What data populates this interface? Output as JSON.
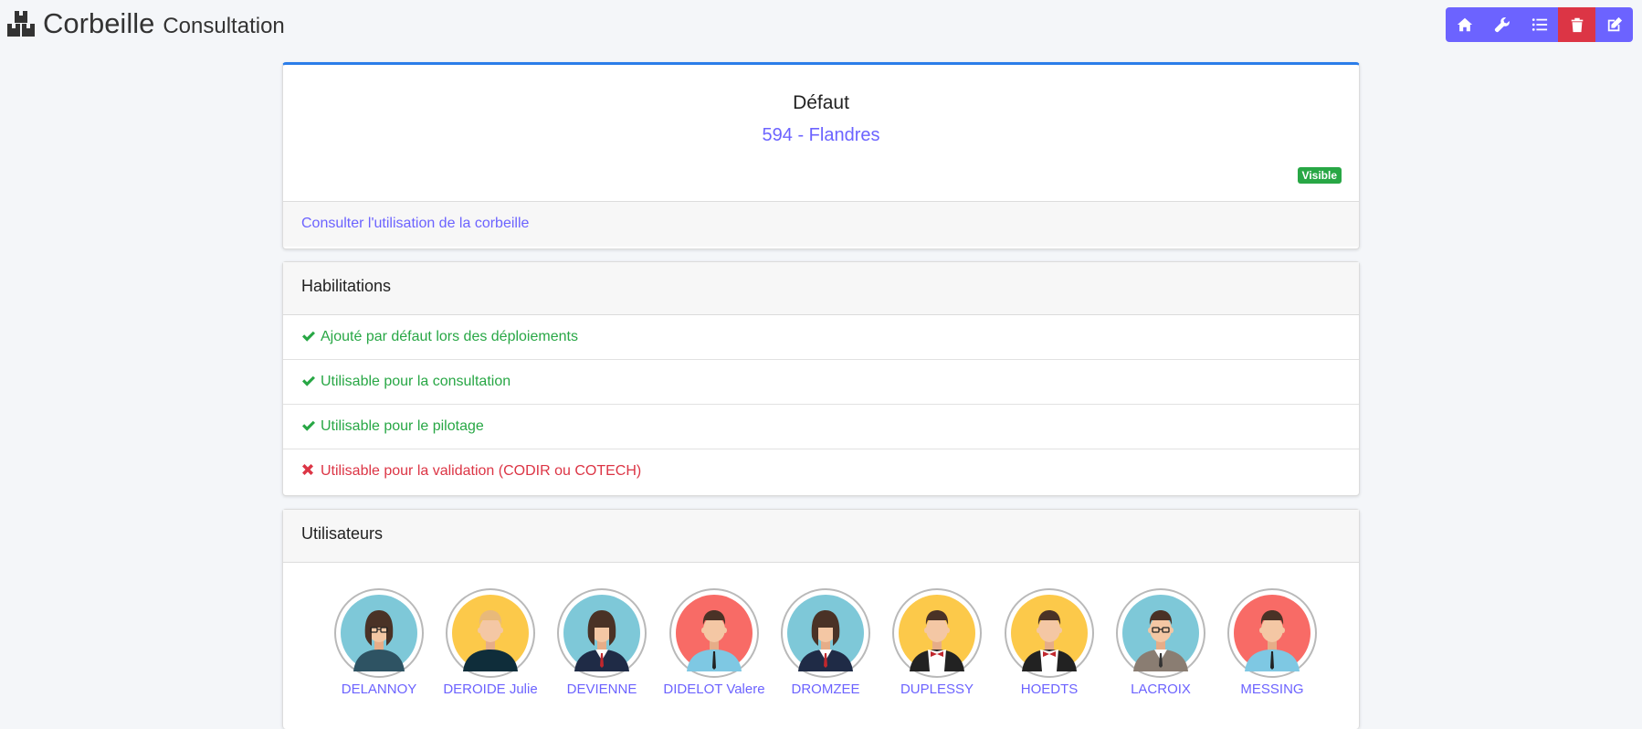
{
  "header": {
    "title": "Corbeille",
    "subtitle": "Consultation"
  },
  "toolbar": {
    "buttons": [
      {
        "icon": "home-icon"
      },
      {
        "icon": "wrench-icon"
      },
      {
        "icon": "list-icon"
      },
      {
        "icon": "trash-icon",
        "color": "#dc3545"
      },
      {
        "icon": "edit-icon"
      }
    ],
    "accent": "#6c63ff"
  },
  "summary": {
    "title": "Défaut",
    "subtitle": "594 - Flandres",
    "badge": "Visible",
    "link": "Consulter l'utilisation de la corbeille"
  },
  "permissions": {
    "title": "Habilitations",
    "items": [
      {
        "label": "Ajouté par défaut lors des déploiements",
        "granted": true
      },
      {
        "label": "Utilisable pour la consultation",
        "granted": true
      },
      {
        "label": "Utilisable pour le pilotage",
        "granted": true
      },
      {
        "label": "Utilisable pour la validation (CODIR ou COTECH)",
        "granted": false
      }
    ]
  },
  "users": {
    "title": "Utilisateurs",
    "items": [
      {
        "name": "DELANNOY",
        "bg": "#7ec8d8",
        "avatar": "woman-glasses"
      },
      {
        "name": "DEROIDE Julie",
        "bg": "#fcc94a",
        "avatar": "man-blond"
      },
      {
        "name": "DEVIENNE",
        "bg": "#7ec8d8",
        "avatar": "woman-suit"
      },
      {
        "name": "DIDELOT Valere",
        "bg": "#f86b66",
        "avatar": "man-shirt"
      },
      {
        "name": "DROMZEE",
        "bg": "#7ec8d8",
        "avatar": "woman-suit"
      },
      {
        "name": "DUPLESSY",
        "bg": "#fcc94a",
        "avatar": "man-bowtie"
      },
      {
        "name": "HOEDTS",
        "bg": "#fcc94a",
        "avatar": "man-bowtie"
      },
      {
        "name": "LACROIX",
        "bg": "#7ec8d8",
        "avatar": "man-glasses-suit"
      },
      {
        "name": "MESSING",
        "bg": "#f86b66",
        "avatar": "man-shirt"
      }
    ]
  }
}
